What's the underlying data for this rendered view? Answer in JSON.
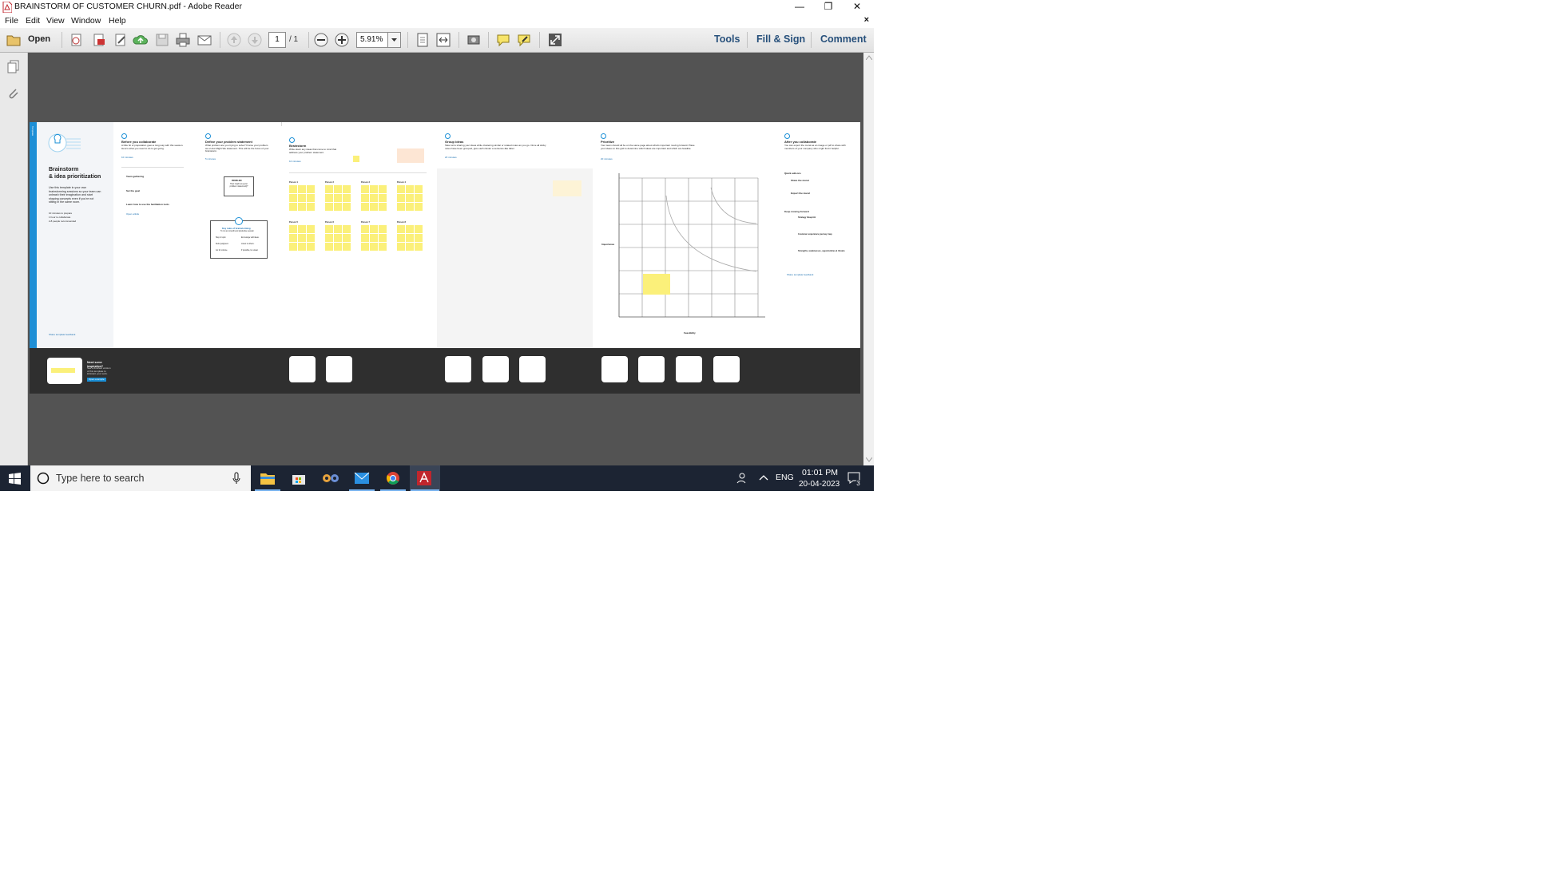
{
  "window": {
    "title": "BRAINSTORM OF CUSTOMER CHURN.pdf - Adobe Reader",
    "minimize": "—",
    "restore": "❐",
    "close": "✕"
  },
  "menu": {
    "items": [
      "File",
      "Edit",
      "View",
      "Window",
      "Help"
    ],
    "close_doc": "×"
  },
  "toolbar": {
    "open_label": "Open",
    "page_current": "1",
    "page_total": "/ 1",
    "zoom_value": "5.91%",
    "tools_label": "Tools",
    "fill_sign_label": "Fill & Sign",
    "comment_label": "Comment",
    "accent": "#27507b"
  },
  "document": {
    "cover": {
      "tag": "Template",
      "title1": "Brainstorm",
      "title2": "& idea prioritization",
      "desc": "Use this template in your own brainstorming sessions so your team can unleash their imagination and start shaping concepts even if you're not sitting in the same room.",
      "bullets": [
        "10 minutes to prepare",
        "1 hour to collaborate",
        "2-8 people recommended"
      ],
      "footer_link": "Share template feedback",
      "band_title": "Need some inspiration?",
      "band_text": "See a finished version of this template to kickstart your work.",
      "band_button": "Open example"
    },
    "before": {
      "heading": "Before you collaborate",
      "text": "A little bit of preparation goes a long way with this session. Here's what you need to do to get going.",
      "time": "10 minutes",
      "items": [
        "Team gathering",
        "Set the goal",
        "Learn how to use the facilitation tools"
      ],
      "link": "Open article"
    },
    "define": {
      "step": "1",
      "heading": "Define your problem statement",
      "text": "What problem are you trying to solve? Frame your problem as a How Might We statement. This will be the focus of your brainstorm.",
      "time": "5 minutes",
      "card_title": "PROBLEM",
      "card_text": "How might we [your problem statement]?",
      "rules_title": "Key rules of brainstorming",
      "rules_sub": "To run an smooth and productive session",
      "rules": [
        "Stay in topic.",
        "Encourage wild ideas.",
        "Defer judgment.",
        "Listen to others.",
        "Go for volume.",
        "If possible, be visual."
      ]
    },
    "brainstorm": {
      "step": "2",
      "heading": "Brainstorm",
      "text": "Write down any ideas that come to mind that address your problem statement.",
      "time": "10 minutes",
      "columns": [
        "Person 1",
        "Person 2",
        "Person 3",
        "Person 4",
        "Person 5",
        "Person 6",
        "Person 7",
        "Person 8"
      ]
    },
    "group": {
      "step": "3",
      "heading": "Group ideas",
      "text": "Take turns sharing your ideas while clustering similar or related notes as you go. Once all sticky notes have been grouped, give each cluster a sentence-like label.",
      "time": "20 minutes"
    },
    "prioritize": {
      "step": "4",
      "heading": "Prioritize",
      "text": "Your team should all be on the same page about what's important moving forward. Place your ideas on this grid to determine which ideas are important and which are feasible.",
      "time": "20 minutes",
      "y_label": "Importance",
      "x_label": "Feasibility"
    },
    "after": {
      "heading": "After you collaborate",
      "text": "You can export the mural as an image or pdf to share with members of your company who might find it helpful.",
      "quick_title": "Quick add-ons",
      "quick": [
        "Share the mural",
        "Export the mural"
      ],
      "keep_title": "Keep moving forward",
      "keep": [
        "Strategy blueprint",
        "Customer experience journey map",
        "Strengths, weaknesses, opportunities & threats"
      ],
      "link": "Share template feedback"
    }
  },
  "taskbar": {
    "search_placeholder": "Type here to search",
    "lang": "ENG",
    "time": "01:01 PM",
    "date": "20-04-2023",
    "notif_count": "3"
  }
}
